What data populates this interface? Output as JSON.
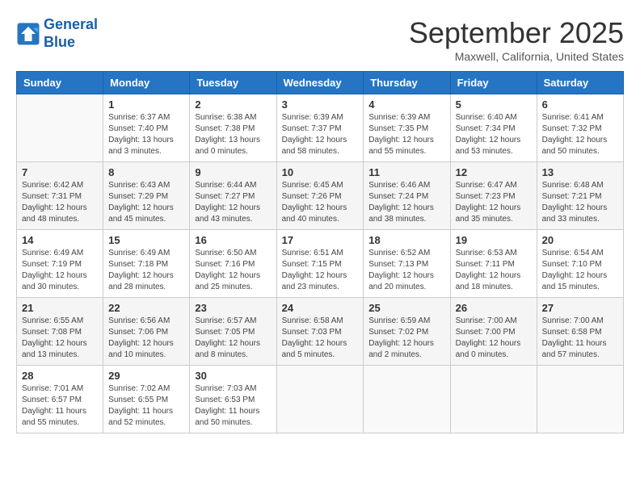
{
  "logo": {
    "line1": "General",
    "line2": "Blue"
  },
  "title": "September 2025",
  "location": "Maxwell, California, United States",
  "days_of_week": [
    "Sunday",
    "Monday",
    "Tuesday",
    "Wednesday",
    "Thursday",
    "Friday",
    "Saturday"
  ],
  "weeks": [
    [
      {
        "day": "",
        "info": ""
      },
      {
        "day": "1",
        "info": "Sunrise: 6:37 AM\nSunset: 7:40 PM\nDaylight: 13 hours\nand 3 minutes."
      },
      {
        "day": "2",
        "info": "Sunrise: 6:38 AM\nSunset: 7:38 PM\nDaylight: 13 hours\nand 0 minutes."
      },
      {
        "day": "3",
        "info": "Sunrise: 6:39 AM\nSunset: 7:37 PM\nDaylight: 12 hours\nand 58 minutes."
      },
      {
        "day": "4",
        "info": "Sunrise: 6:39 AM\nSunset: 7:35 PM\nDaylight: 12 hours\nand 55 minutes."
      },
      {
        "day": "5",
        "info": "Sunrise: 6:40 AM\nSunset: 7:34 PM\nDaylight: 12 hours\nand 53 minutes."
      },
      {
        "day": "6",
        "info": "Sunrise: 6:41 AM\nSunset: 7:32 PM\nDaylight: 12 hours\nand 50 minutes."
      }
    ],
    [
      {
        "day": "7",
        "info": "Sunrise: 6:42 AM\nSunset: 7:31 PM\nDaylight: 12 hours\nand 48 minutes."
      },
      {
        "day": "8",
        "info": "Sunrise: 6:43 AM\nSunset: 7:29 PM\nDaylight: 12 hours\nand 45 minutes."
      },
      {
        "day": "9",
        "info": "Sunrise: 6:44 AM\nSunset: 7:27 PM\nDaylight: 12 hours\nand 43 minutes."
      },
      {
        "day": "10",
        "info": "Sunrise: 6:45 AM\nSunset: 7:26 PM\nDaylight: 12 hours\nand 40 minutes."
      },
      {
        "day": "11",
        "info": "Sunrise: 6:46 AM\nSunset: 7:24 PM\nDaylight: 12 hours\nand 38 minutes."
      },
      {
        "day": "12",
        "info": "Sunrise: 6:47 AM\nSunset: 7:23 PM\nDaylight: 12 hours\nand 35 minutes."
      },
      {
        "day": "13",
        "info": "Sunrise: 6:48 AM\nSunset: 7:21 PM\nDaylight: 12 hours\nand 33 minutes."
      }
    ],
    [
      {
        "day": "14",
        "info": "Sunrise: 6:49 AM\nSunset: 7:19 PM\nDaylight: 12 hours\nand 30 minutes."
      },
      {
        "day": "15",
        "info": "Sunrise: 6:49 AM\nSunset: 7:18 PM\nDaylight: 12 hours\nand 28 minutes."
      },
      {
        "day": "16",
        "info": "Sunrise: 6:50 AM\nSunset: 7:16 PM\nDaylight: 12 hours\nand 25 minutes."
      },
      {
        "day": "17",
        "info": "Sunrise: 6:51 AM\nSunset: 7:15 PM\nDaylight: 12 hours\nand 23 minutes."
      },
      {
        "day": "18",
        "info": "Sunrise: 6:52 AM\nSunset: 7:13 PM\nDaylight: 12 hours\nand 20 minutes."
      },
      {
        "day": "19",
        "info": "Sunrise: 6:53 AM\nSunset: 7:11 PM\nDaylight: 12 hours\nand 18 minutes."
      },
      {
        "day": "20",
        "info": "Sunrise: 6:54 AM\nSunset: 7:10 PM\nDaylight: 12 hours\nand 15 minutes."
      }
    ],
    [
      {
        "day": "21",
        "info": "Sunrise: 6:55 AM\nSunset: 7:08 PM\nDaylight: 12 hours\nand 13 minutes."
      },
      {
        "day": "22",
        "info": "Sunrise: 6:56 AM\nSunset: 7:06 PM\nDaylight: 12 hours\nand 10 minutes."
      },
      {
        "day": "23",
        "info": "Sunrise: 6:57 AM\nSunset: 7:05 PM\nDaylight: 12 hours\nand 8 minutes."
      },
      {
        "day": "24",
        "info": "Sunrise: 6:58 AM\nSunset: 7:03 PM\nDaylight: 12 hours\nand 5 minutes."
      },
      {
        "day": "25",
        "info": "Sunrise: 6:59 AM\nSunset: 7:02 PM\nDaylight: 12 hours\nand 2 minutes."
      },
      {
        "day": "26",
        "info": "Sunrise: 7:00 AM\nSunset: 7:00 PM\nDaylight: 12 hours\nand 0 minutes."
      },
      {
        "day": "27",
        "info": "Sunrise: 7:00 AM\nSunset: 6:58 PM\nDaylight: 11 hours\nand 57 minutes."
      }
    ],
    [
      {
        "day": "28",
        "info": "Sunrise: 7:01 AM\nSunset: 6:57 PM\nDaylight: 11 hours\nand 55 minutes."
      },
      {
        "day": "29",
        "info": "Sunrise: 7:02 AM\nSunset: 6:55 PM\nDaylight: 11 hours\nand 52 minutes."
      },
      {
        "day": "30",
        "info": "Sunrise: 7:03 AM\nSunset: 6:53 PM\nDaylight: 11 hours\nand 50 minutes."
      },
      {
        "day": "",
        "info": ""
      },
      {
        "day": "",
        "info": ""
      },
      {
        "day": "",
        "info": ""
      },
      {
        "day": "",
        "info": ""
      }
    ]
  ]
}
